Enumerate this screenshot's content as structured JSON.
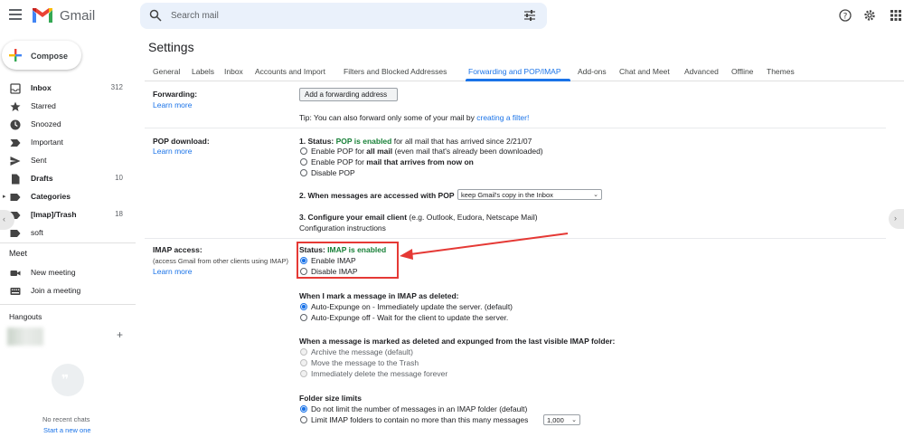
{
  "app": {
    "name": "Gmail"
  },
  "search": {
    "placeholder": "Search mail"
  },
  "compose": {
    "label": "Compose"
  },
  "sidebar": {
    "items": [
      {
        "label": "Inbox",
        "count": "312",
        "bold": true
      },
      {
        "label": "Starred",
        "count": ""
      },
      {
        "label": "Snoozed",
        "count": ""
      },
      {
        "label": "Important",
        "count": ""
      },
      {
        "label": "Sent",
        "count": ""
      },
      {
        "label": "Drafts",
        "count": "10",
        "bold": true
      },
      {
        "label": "Categories",
        "count": "",
        "bold": true
      },
      {
        "label": "[Imap]/Trash",
        "count": "18",
        "bold": true
      },
      {
        "label": "soft",
        "count": ""
      }
    ],
    "meet_title": "Meet",
    "meet_items": [
      "New meeting",
      "Join a meeting"
    ],
    "hangouts_title": "Hangouts",
    "no_recent": "No recent chats",
    "start_new": "Start a new one"
  },
  "settings": {
    "title": "Settings",
    "tabs": [
      "General",
      "Labels",
      "Inbox",
      "Accounts and Import",
      "Filters and Blocked Addresses",
      "Forwarding and POP/IMAP",
      "Add-ons",
      "Chat and Meet",
      "Advanced",
      "Offline",
      "Themes"
    ],
    "active_tab": "Forwarding and POP/IMAP",
    "learn_more": "Learn more",
    "forwarding": {
      "label": "Forwarding:",
      "button": "Add a forwarding address",
      "tip_prefix": "Tip: You can also forward only some of your mail by ",
      "tip_link": "creating a filter!"
    },
    "pop": {
      "label": "POP download:",
      "status_prefix": "1. Status: ",
      "status_value": "POP is enabled",
      "status_suffix": " for all mail that has arrived since 2/21/07",
      "opt1_pre": "Enable POP for ",
      "opt1_bold": "all mail",
      "opt1_post": " (even mail that's already been downloaded)",
      "opt2_pre": "Enable POP for ",
      "opt2_bold": "mail that arrives from now on",
      "opt3": "Disable POP",
      "q2": "2. When messages are accessed with POP",
      "q2_select": "keep Gmail's copy in the Inbox",
      "q3_bold": "3. Configure your email client",
      "q3_rest": " (e.g. Outlook, Eudora, Netscape Mail)",
      "config_link": "Configuration instructions"
    },
    "imap": {
      "label": "IMAP access:",
      "sub": "(access Gmail from other clients using IMAP)",
      "status_prefix": "Status: ",
      "status_value": "IMAP is enabled",
      "enable": "Enable IMAP",
      "disable": "Disable IMAP",
      "deleted_title": "When I mark a message in IMAP as deleted:",
      "auto_on": "Auto-Expunge on - Immediately update the server. (default)",
      "auto_off": "Auto-Expunge off - Wait for the client to update the server.",
      "expunged_title": "When a message is marked as deleted and expunged from the last visible IMAP folder:",
      "archive": "Archive the message (default)",
      "trash": "Move the message to the Trash",
      "delete": "Immediately delete the message forever",
      "folder_title": "Folder size limits",
      "no_limit": "Do not limit the number of messages in an IMAP folder (default)",
      "limit": "Limit IMAP folders to contain no more than this many messages",
      "limit_value": "1,000"
    }
  },
  "colors": {
    "accent": "#1a73e8",
    "enabled_green": "#188038",
    "highlight_red": "#e53935"
  }
}
